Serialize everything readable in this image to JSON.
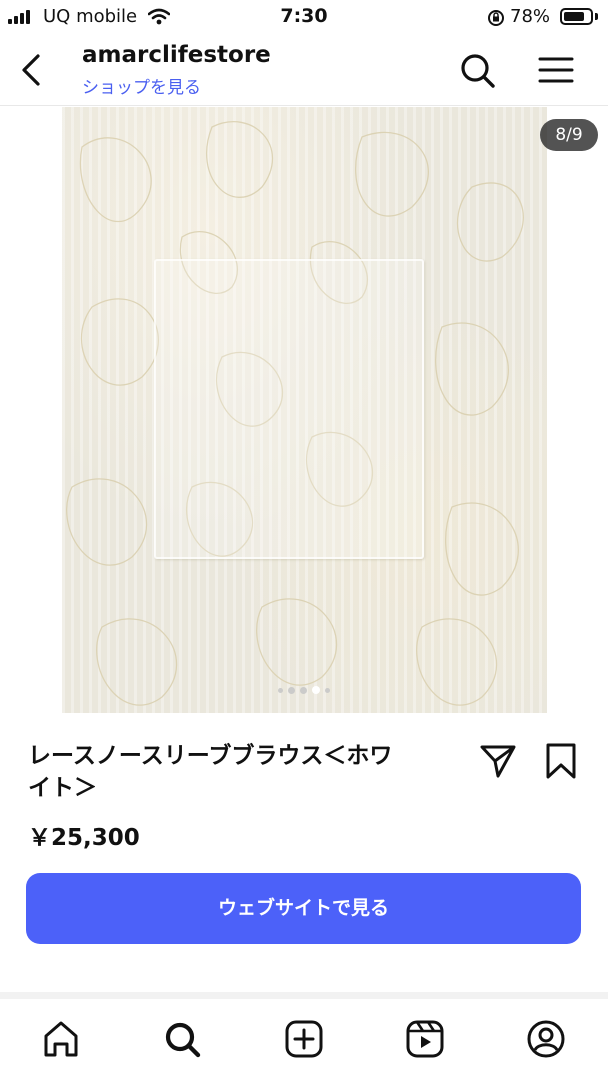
{
  "status_bar": {
    "carrier": "UQ mobile",
    "time": "7:30",
    "battery_percent": "78%",
    "battery_level": 0.78,
    "icons": [
      "signal-icon",
      "wifi-icon",
      "rotation-lock-icon",
      "battery-icon"
    ]
  },
  "header": {
    "account_name": "amarclifestore",
    "shop_link": "ショップを見る",
    "icons": [
      "back-chevron-icon",
      "search-icon",
      "menu-icon"
    ]
  },
  "product_image": {
    "counter": "8/9",
    "current_index": 8,
    "total": 9,
    "visible_dots": 5,
    "active_dot": 4
  },
  "product": {
    "title_line1": "レースノースリーブブラウス＜ホワ",
    "title_line2": "イト＞",
    "price": "￥25,300",
    "icons": [
      "share-icon",
      "bookmark-icon"
    ]
  },
  "actions": {
    "website_button": "ウェブサイトで見る"
  },
  "colors": {
    "accent": "#4c61f9",
    "link": "#4a5ff0",
    "text": "#111111"
  },
  "bottom_nav": {
    "items": [
      {
        "icon": "home-icon"
      },
      {
        "icon": "search-icon",
        "active": true
      },
      {
        "icon": "create-icon"
      },
      {
        "icon": "reels-icon"
      },
      {
        "icon": "profile-icon"
      }
    ]
  }
}
